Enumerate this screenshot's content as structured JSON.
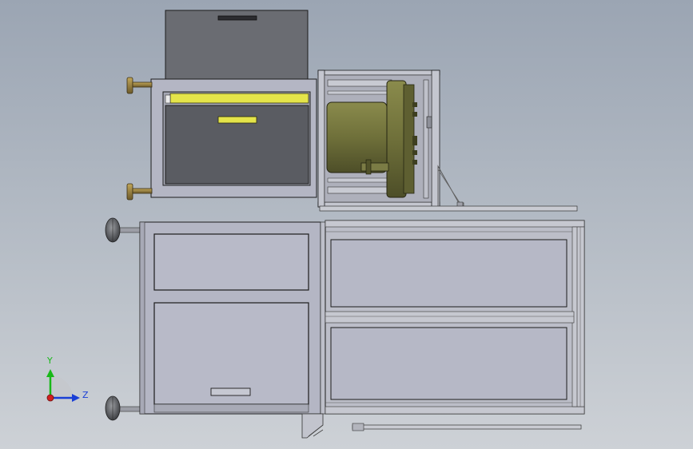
{
  "viewport": {
    "background_top": "#9ba5b3",
    "background_bottom": "#cdd1d6"
  },
  "colors": {
    "panel_fill": "#b4b6c4",
    "panel_fill_dark": "#5a5c62",
    "frame_stroke": "#1c1c1c",
    "yellow_accent": "#e4e44a",
    "motor_olive": "#6f703a",
    "foot_brass": "#8f7a3e",
    "caster_gray": "#6d6f73"
  },
  "triad": {
    "y_label": "Y",
    "z_label": "Z",
    "y_color": "#18b818",
    "z_color": "#1a3fd6",
    "origin_color": "#d12020"
  }
}
